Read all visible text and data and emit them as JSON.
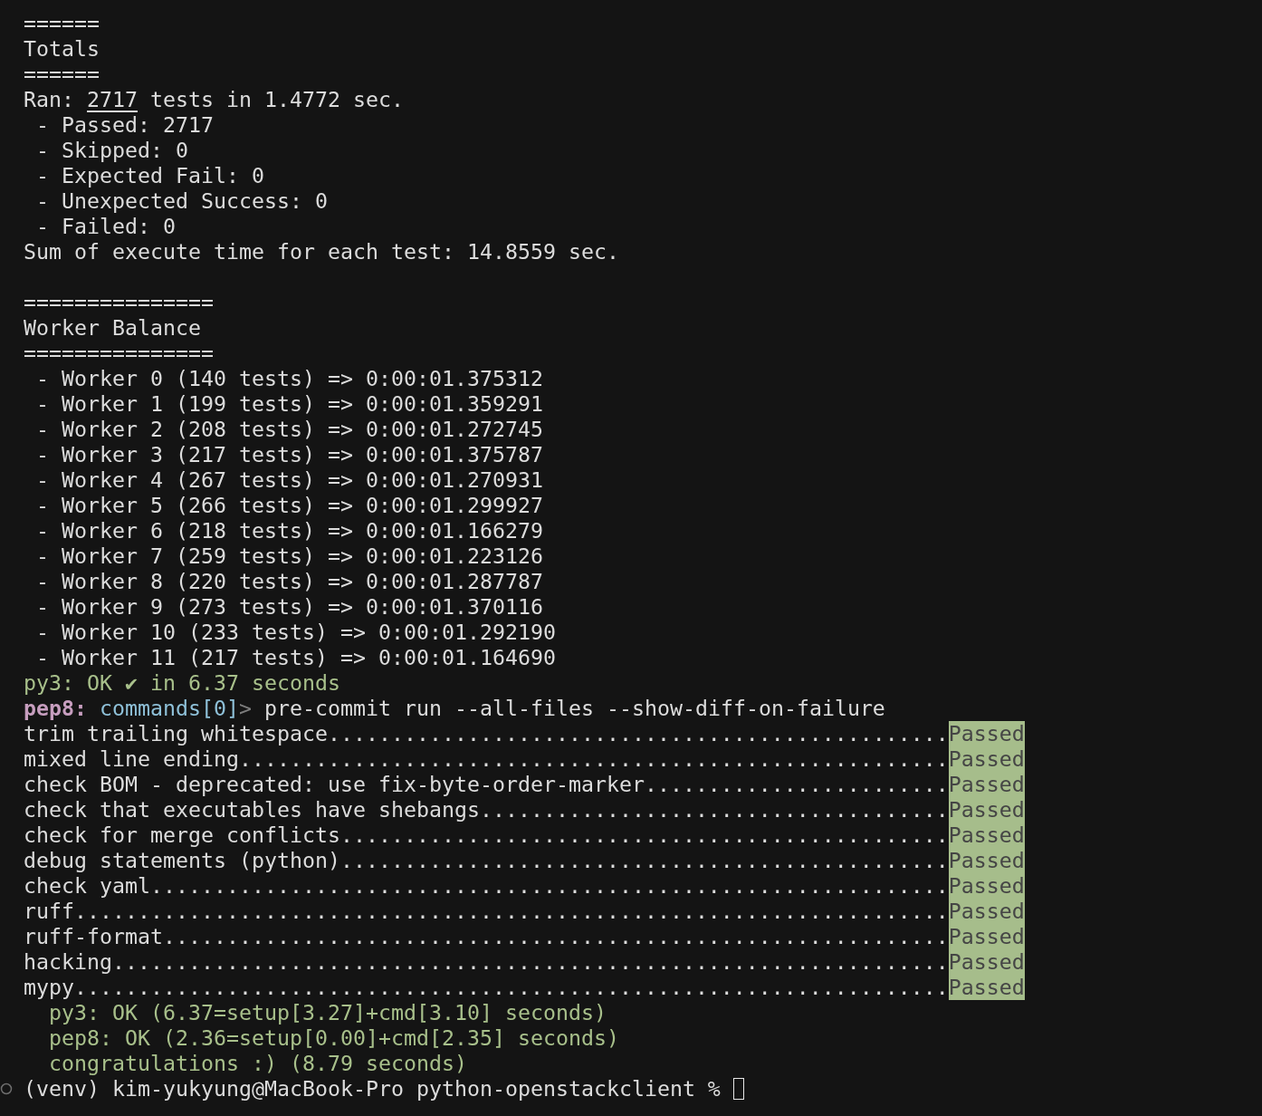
{
  "terminal": {
    "lines": [
      {
        "kind": "plain",
        "text": "======"
      },
      {
        "kind": "plain",
        "text": "Totals"
      },
      {
        "kind": "plain",
        "text": "======"
      },
      {
        "kind": "ran",
        "prefix": "Ran: ",
        "count": "2717",
        "suffix": " tests in 1.4772 sec."
      },
      {
        "kind": "item",
        "text": "- Passed: 2717"
      },
      {
        "kind": "item",
        "text": "- Skipped: 0"
      },
      {
        "kind": "item",
        "text": "- Expected Fail: 0"
      },
      {
        "kind": "item",
        "text": "- Unexpected Success: 0"
      },
      {
        "kind": "item",
        "text": "- Failed: 0"
      },
      {
        "kind": "plain",
        "text": "Sum of execute time for each test: 14.8559 sec."
      },
      {
        "kind": "blank"
      },
      {
        "kind": "plain",
        "text": "==============="
      },
      {
        "kind": "plain",
        "text": "Worker Balance"
      },
      {
        "kind": "plain",
        "text": "==============="
      },
      {
        "kind": "item",
        "text": "- Worker 0 (140 tests) => 0:00:01.375312"
      },
      {
        "kind": "item",
        "text": "- Worker 1 (199 tests) => 0:00:01.359291"
      },
      {
        "kind": "item",
        "text": "- Worker 2 (208 tests) => 0:00:01.272745"
      },
      {
        "kind": "item",
        "text": "- Worker 3 (217 tests) => 0:00:01.375787"
      },
      {
        "kind": "item",
        "text": "- Worker 4 (267 tests) => 0:00:01.270931"
      },
      {
        "kind": "item",
        "text": "- Worker 5 (266 tests) => 0:00:01.299927"
      },
      {
        "kind": "item",
        "text": "- Worker 6 (218 tests) => 0:00:01.166279"
      },
      {
        "kind": "item",
        "text": "- Worker 7 (259 tests) => 0:00:01.223126"
      },
      {
        "kind": "item",
        "text": "- Worker 8 (220 tests) => 0:00:01.287787"
      },
      {
        "kind": "item",
        "text": "- Worker 9 (273 tests) => 0:00:01.370116"
      },
      {
        "kind": "item",
        "text": "- Worker 10 (233 tests) => 0:00:01.292190"
      },
      {
        "kind": "item",
        "text": "- Worker 11 (217 tests) => 0:00:01.164690"
      },
      {
        "kind": "success",
        "text": "py3: OK ✔ in 6.37 seconds"
      },
      {
        "kind": "command",
        "env": "pep8:",
        "step": "commands[0]",
        "arrow": ">",
        "text": "pre-commit run --all-files --show-diff-on-failure"
      },
      {
        "kind": "hook",
        "text": "trim trailing whitespace.................................................",
        "result": "Passed"
      },
      {
        "kind": "hook",
        "text": "mixed line ending........................................................",
        "result": "Passed"
      },
      {
        "kind": "hook",
        "text": "check BOM - deprecated: use fix-byte-order-marker........................",
        "result": "Passed"
      },
      {
        "kind": "hook",
        "text": "check that executables have shebangs.....................................",
        "result": "Passed"
      },
      {
        "kind": "hook",
        "text": "check for merge conflicts................................................",
        "result": "Passed"
      },
      {
        "kind": "hook",
        "text": "debug statements (python)................................................",
        "result": "Passed"
      },
      {
        "kind": "hook",
        "text": "check yaml...............................................................",
        "result": "Passed"
      },
      {
        "kind": "hook",
        "text": "ruff.....................................................................",
        "result": "Passed"
      },
      {
        "kind": "hook",
        "text": "ruff-format..............................................................",
        "result": "Passed"
      },
      {
        "kind": "hook",
        "text": "hacking..................................................................",
        "result": "Passed"
      },
      {
        "kind": "hook",
        "text": "mypy.....................................................................",
        "result": "Passed"
      },
      {
        "kind": "summary",
        "text": "py3: OK (6.37=setup[3.27]+cmd[3.10] seconds)"
      },
      {
        "kind": "summary",
        "text": "pep8: OK (2.36=setup[0.00]+cmd[2.35] seconds)"
      },
      {
        "kind": "summary",
        "text": "congratulations :) (8.79 seconds)"
      },
      {
        "kind": "prompt",
        "text": "(venv) kim-yukyung@MacBook-Pro python-openstackclient %"
      }
    ]
  }
}
